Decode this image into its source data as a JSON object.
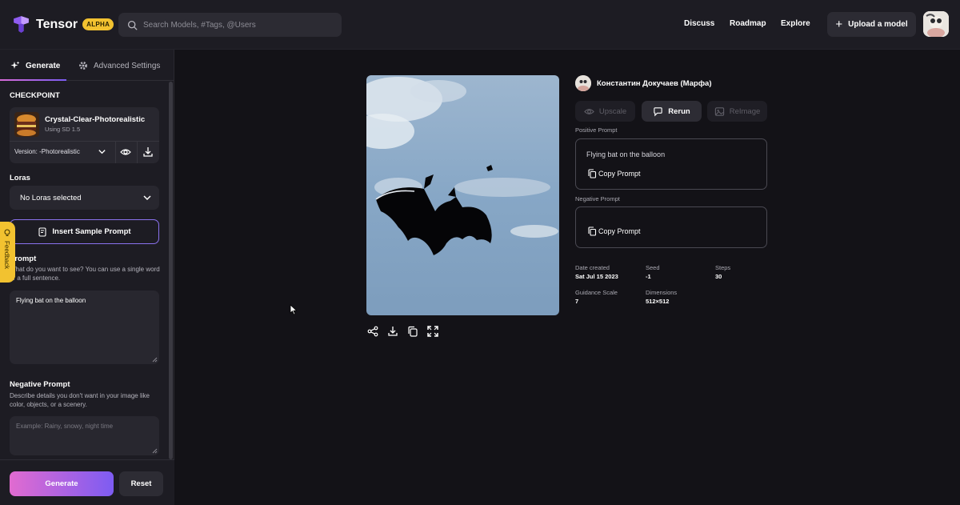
{
  "brand": {
    "name": "Tensor",
    "badge": "ALPHA"
  },
  "search": {
    "placeholder": "Search Models, #Tags, @Users",
    "icon": "search-icon"
  },
  "nav": {
    "discuss": "Discuss",
    "roadmap": "Roadmap",
    "explore": "Explore",
    "upload": "Upload a model"
  },
  "sidebar": {
    "tabs": {
      "generate": "Generate",
      "advanced": "Advanced Settings"
    },
    "checkpoint": {
      "title": "CHECKPOINT",
      "name": "Crystal-Clear-Photorealistic",
      "sub": "Using SD 1.5",
      "version": "Version: -Photorealistic"
    },
    "loras": {
      "title": "Loras",
      "value": "No Loras selected"
    },
    "sample_prompt": "Insert Sample Prompt",
    "prompt": {
      "title": "Prompt",
      "description": "What do you want to see? You can use a single word or a full sentence.",
      "value": "Flying bat on the balloon"
    },
    "negative": {
      "title": "Negative Prompt",
      "description": "Describe details you don't want in your image like color, objects, or a scenery.",
      "placeholder": "Example: Rainy, snowy, night time"
    },
    "generate": "Generate",
    "reset": "Reset",
    "feedback": "Feedback"
  },
  "detail": {
    "user": "Константин Докучаев (Марфа)",
    "actions": {
      "upscale": "Upscale",
      "rerun": "Rerun",
      "reimage": "ReImage"
    },
    "positive_label": "Positive Prompt",
    "positive_text": "Flying bat on the balloon",
    "negative_label": "Negative Prompt",
    "copy": "Copy Prompt",
    "meta": {
      "date_label": "Date created",
      "date": "Sat Jul 15 2023",
      "seed_label": "Seed",
      "seed": "-1",
      "steps_label": "Steps",
      "steps": "30",
      "guidance_label": "Guidance Scale",
      "guidance": "7",
      "dim_label": "Dimensions",
      "dim": "512×512"
    }
  },
  "colors": {
    "accent_start": "#e16bd0",
    "accent_end": "#7d5cf2",
    "badge": "#f2c230",
    "bg": "#131217",
    "panel": "#1d1c23"
  }
}
